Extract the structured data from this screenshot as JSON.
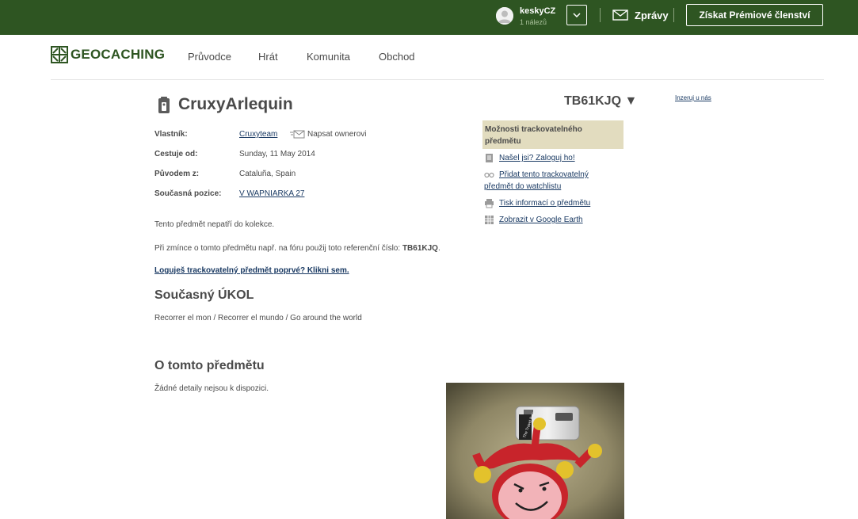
{
  "topbar": {
    "username": "keskyCZ",
    "finds": "1 nálezů",
    "messages_label": "Zprávy",
    "premium_label": "Získat Prémiové členství"
  },
  "brand": {
    "logo_text": "GEOCACHING"
  },
  "nav": {
    "items": [
      "Průvodce",
      "Hrát",
      "Komunita",
      "Obchod"
    ]
  },
  "trackable": {
    "name": "CruxyArlequin",
    "code": "TB61KJQ",
    "code_caret": "▼",
    "details": {
      "owner_label": "Vlastník:",
      "owner_value": "Cruxyteam",
      "message_owner": "Napsat ownerovi",
      "travel_since_label": "Cestuje od:",
      "travel_since_value": "Sunday, 11 May 2014",
      "origin_label": "Původem z:",
      "origin_value": "Cataluña, Spain",
      "position_label": "Současná pozice:",
      "position_value": "V WAPNIARKA 27"
    },
    "collection_note": "Tento předmět nepatří do kolekce.",
    "reference_prefix": "Při zmínce o tomto předmětu např. na fóru použij toto referenční číslo: ",
    "reference_code": "TB61KJQ",
    "reference_suffix": ".",
    "first_log_link": "Loguješ trackovatelný předmět poprvé? Klikni sem.",
    "goal_heading": "Současný ÚKOL",
    "goal_text": "Recorrer el mon / Recorrer el mundo / Go around the world",
    "about_heading": "O tomto předmětu",
    "about_text": "Žádné detaily nejsou k dispozici."
  },
  "sidebar": {
    "options_title_1": "Možnosti trackovatelného",
    "options_title_2": "předmětu",
    "option_log": "Našel jsi? Zaloguj ho!",
    "option_watch_1": "Přidat tento trackovatelný",
    "option_watch_2": "předmět do watchlistu",
    "option_print": "Tisk informací o předmětu",
    "option_earth": "Zobrazit v Google Earth",
    "advert_link": "Inzeruj u nás"
  },
  "photo": {
    "tag_text": "The Travel Bug"
  },
  "colors": {
    "topbar": "#2e5522",
    "link": "#1a3a63",
    "options_bg": "#e2dcbf"
  }
}
